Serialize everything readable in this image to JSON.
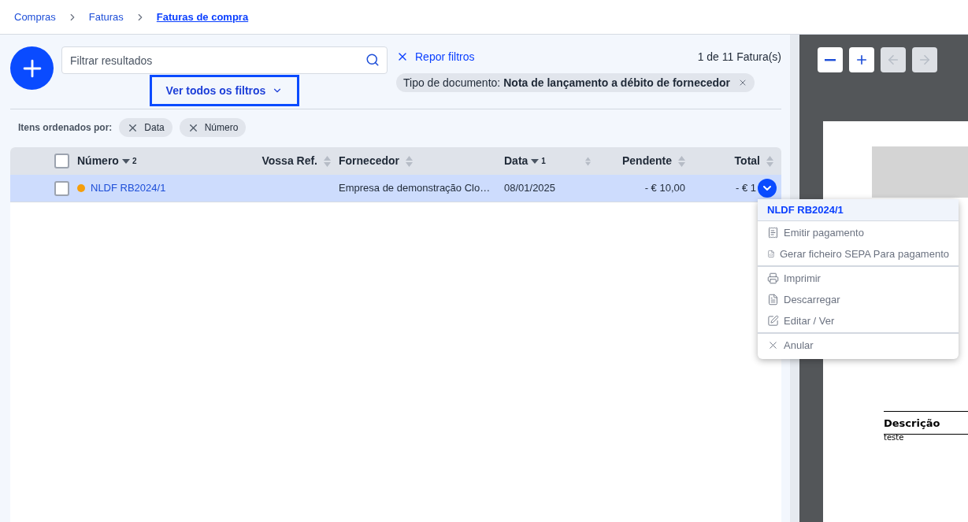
{
  "breadcrumb": [
    {
      "label": "Compras",
      "current": false
    },
    {
      "label": "Faturas",
      "current": false
    },
    {
      "label": "Faturas de compra",
      "current": true
    }
  ],
  "search": {
    "placeholder": "Filtrar resultados"
  },
  "all_filters_button": {
    "label": "Ver todos os filtros"
  },
  "reset_filters": {
    "label": "Repor filtros"
  },
  "count": "1 de 11 Fatura(s)",
  "active_filters": [
    {
      "name": "Tipo de documento:",
      "value": "Nota de lançamento a débito de fornecedor"
    }
  ],
  "sort_label": "Itens ordenados por:",
  "sort_chips": [
    {
      "label": "Data"
    },
    {
      "label": "Número"
    }
  ],
  "table": {
    "select_all": {
      "checked": false
    },
    "columns": [
      {
        "label": "Número",
        "sorted": true,
        "sort_order": "2"
      },
      {
        "label": "Vossa Ref.",
        "sorted": false
      },
      {
        "label": "Fornecedor",
        "sorted": false
      },
      {
        "label": "Data",
        "sorted": true,
        "sort_order": "1"
      },
      {
        "sorted": false
      },
      {
        "label": "Pendente",
        "sorted": false
      },
      {
        "label": "Total",
        "sorted": false
      }
    ],
    "rows": [
      {
        "selected": true,
        "checked": false,
        "color": "#f59e0b",
        "cells": [
          "NLDF RB2024/1",
          "",
          "Empresa de demonstração Clo…",
          "08/01/2025",
          "",
          "- € 10,00",
          "- € 1"
        ]
      }
    ]
  },
  "menu": {
    "title": "NLDF RB2024/1",
    "groups": [
      [
        "Emitir pagamento",
        "Gerar ficheiro SEPA Para pagamento"
      ],
      [
        "Imprimir",
        "Descarregar",
        "Editar / Ver"
      ],
      [
        "Anular"
      ]
    ]
  },
  "viewer": {
    "controls": [
      {
        "kind": "zoom-out",
        "disabled": false
      },
      {
        "kind": "zoom-in",
        "disabled": false
      },
      {
        "kind": "prev",
        "disabled": true
      },
      {
        "kind": "next",
        "disabled": true
      }
    ],
    "document": {
      "section_title": "Descrição",
      "section_text": "teste"
    }
  }
}
